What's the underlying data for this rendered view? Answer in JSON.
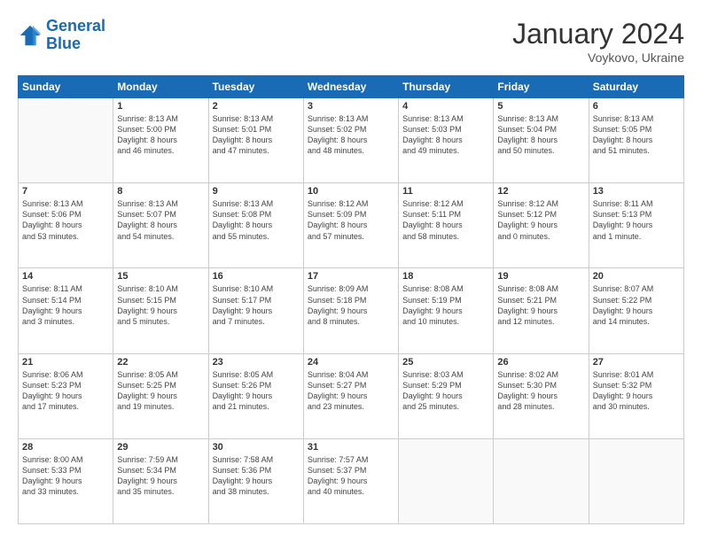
{
  "logo": {
    "line1": "General",
    "line2": "Blue"
  },
  "header": {
    "month_year": "January 2024",
    "location": "Voykovo, Ukraine"
  },
  "weekdays": [
    "Sunday",
    "Monday",
    "Tuesday",
    "Wednesday",
    "Thursday",
    "Friday",
    "Saturday"
  ],
  "weeks": [
    [
      {
        "day": "",
        "info": ""
      },
      {
        "day": "1",
        "info": "Sunrise: 8:13 AM\nSunset: 5:00 PM\nDaylight: 8 hours\nand 46 minutes."
      },
      {
        "day": "2",
        "info": "Sunrise: 8:13 AM\nSunset: 5:01 PM\nDaylight: 8 hours\nand 47 minutes."
      },
      {
        "day": "3",
        "info": "Sunrise: 8:13 AM\nSunset: 5:02 PM\nDaylight: 8 hours\nand 48 minutes."
      },
      {
        "day": "4",
        "info": "Sunrise: 8:13 AM\nSunset: 5:03 PM\nDaylight: 8 hours\nand 49 minutes."
      },
      {
        "day": "5",
        "info": "Sunrise: 8:13 AM\nSunset: 5:04 PM\nDaylight: 8 hours\nand 50 minutes."
      },
      {
        "day": "6",
        "info": "Sunrise: 8:13 AM\nSunset: 5:05 PM\nDaylight: 8 hours\nand 51 minutes."
      }
    ],
    [
      {
        "day": "7",
        "info": "Sunrise: 8:13 AM\nSunset: 5:06 PM\nDaylight: 8 hours\nand 53 minutes."
      },
      {
        "day": "8",
        "info": "Sunrise: 8:13 AM\nSunset: 5:07 PM\nDaylight: 8 hours\nand 54 minutes."
      },
      {
        "day": "9",
        "info": "Sunrise: 8:13 AM\nSunset: 5:08 PM\nDaylight: 8 hours\nand 55 minutes."
      },
      {
        "day": "10",
        "info": "Sunrise: 8:12 AM\nSunset: 5:09 PM\nDaylight: 8 hours\nand 57 minutes."
      },
      {
        "day": "11",
        "info": "Sunrise: 8:12 AM\nSunset: 5:11 PM\nDaylight: 8 hours\nand 58 minutes."
      },
      {
        "day": "12",
        "info": "Sunrise: 8:12 AM\nSunset: 5:12 PM\nDaylight: 9 hours\nand 0 minutes."
      },
      {
        "day": "13",
        "info": "Sunrise: 8:11 AM\nSunset: 5:13 PM\nDaylight: 9 hours\nand 1 minute."
      }
    ],
    [
      {
        "day": "14",
        "info": "Sunrise: 8:11 AM\nSunset: 5:14 PM\nDaylight: 9 hours\nand 3 minutes."
      },
      {
        "day": "15",
        "info": "Sunrise: 8:10 AM\nSunset: 5:15 PM\nDaylight: 9 hours\nand 5 minutes."
      },
      {
        "day": "16",
        "info": "Sunrise: 8:10 AM\nSunset: 5:17 PM\nDaylight: 9 hours\nand 7 minutes."
      },
      {
        "day": "17",
        "info": "Sunrise: 8:09 AM\nSunset: 5:18 PM\nDaylight: 9 hours\nand 8 minutes."
      },
      {
        "day": "18",
        "info": "Sunrise: 8:08 AM\nSunset: 5:19 PM\nDaylight: 9 hours\nand 10 minutes."
      },
      {
        "day": "19",
        "info": "Sunrise: 8:08 AM\nSunset: 5:21 PM\nDaylight: 9 hours\nand 12 minutes."
      },
      {
        "day": "20",
        "info": "Sunrise: 8:07 AM\nSunset: 5:22 PM\nDaylight: 9 hours\nand 14 minutes."
      }
    ],
    [
      {
        "day": "21",
        "info": "Sunrise: 8:06 AM\nSunset: 5:23 PM\nDaylight: 9 hours\nand 17 minutes."
      },
      {
        "day": "22",
        "info": "Sunrise: 8:05 AM\nSunset: 5:25 PM\nDaylight: 9 hours\nand 19 minutes."
      },
      {
        "day": "23",
        "info": "Sunrise: 8:05 AM\nSunset: 5:26 PM\nDaylight: 9 hours\nand 21 minutes."
      },
      {
        "day": "24",
        "info": "Sunrise: 8:04 AM\nSunset: 5:27 PM\nDaylight: 9 hours\nand 23 minutes."
      },
      {
        "day": "25",
        "info": "Sunrise: 8:03 AM\nSunset: 5:29 PM\nDaylight: 9 hours\nand 25 minutes."
      },
      {
        "day": "26",
        "info": "Sunrise: 8:02 AM\nSunset: 5:30 PM\nDaylight: 9 hours\nand 28 minutes."
      },
      {
        "day": "27",
        "info": "Sunrise: 8:01 AM\nSunset: 5:32 PM\nDaylight: 9 hours\nand 30 minutes."
      }
    ],
    [
      {
        "day": "28",
        "info": "Sunrise: 8:00 AM\nSunset: 5:33 PM\nDaylight: 9 hours\nand 33 minutes."
      },
      {
        "day": "29",
        "info": "Sunrise: 7:59 AM\nSunset: 5:34 PM\nDaylight: 9 hours\nand 35 minutes."
      },
      {
        "day": "30",
        "info": "Sunrise: 7:58 AM\nSunset: 5:36 PM\nDaylight: 9 hours\nand 38 minutes."
      },
      {
        "day": "31",
        "info": "Sunrise: 7:57 AM\nSunset: 5:37 PM\nDaylight: 9 hours\nand 40 minutes."
      },
      {
        "day": "",
        "info": ""
      },
      {
        "day": "",
        "info": ""
      },
      {
        "day": "",
        "info": ""
      }
    ]
  ]
}
